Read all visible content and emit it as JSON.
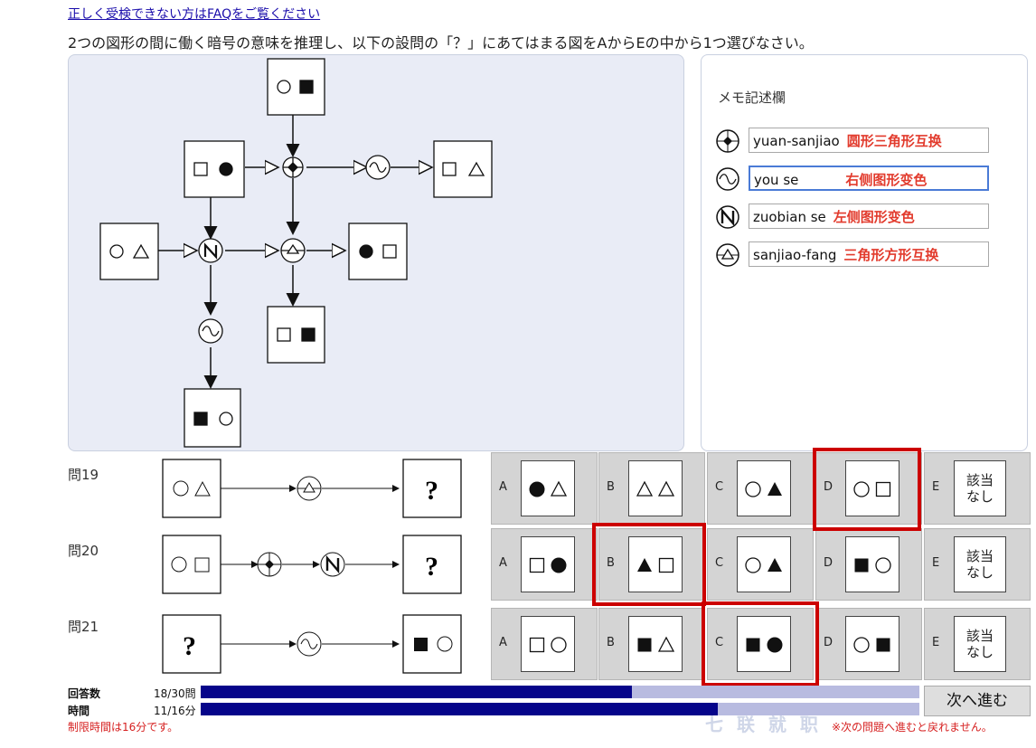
{
  "header": {
    "faq_link": "正しく受検できない方はFAQをご覧ください",
    "instruction": "2つの図形の間に働く暗号の意味を推理し、以下の設問の「？」にあてはまる図をAからEの中から1つ選びなさい。"
  },
  "memo": {
    "title": "メモ記述欄",
    "rows": [
      {
        "icon": "cross-circle-icon",
        "key": "yuan-sanjiao",
        "note": "圆形三角形互换"
      },
      {
        "icon": "wave-circle-icon",
        "key": "you se",
        "note": "右侧图形变色"
      },
      {
        "icon": "n-circle-icon",
        "key": "zuobian se",
        "note": "左侧图形变色"
      },
      {
        "icon": "triangle-circle-icon",
        "key": "sanjiao-fang",
        "note": "三角形方形互换"
      }
    ]
  },
  "questions": [
    {
      "label": "問19",
      "left_shapes": [
        "circle-empty",
        "triangle-empty"
      ],
      "ops": [
        "triangle-circle-icon"
      ],
      "question_mark": "?",
      "right": "?"
    },
    {
      "label": "問20",
      "left_shapes": [
        "circle-empty",
        "square-empty"
      ],
      "ops": [
        "cross-circle-icon",
        "n-circle-icon"
      ],
      "question_mark": "?",
      "right": "?"
    },
    {
      "label": "問21",
      "left": "?",
      "ops": [
        "wave-circle-icon"
      ],
      "question_mark": "?",
      "right_shapes": [
        "square-filled",
        "circle-empty"
      ]
    }
  ],
  "options": {
    "letters": [
      "A",
      "B",
      "C",
      "D",
      "E"
    ],
    "none_label_1": "該当",
    "none_label_2": "なし",
    "q19": [
      [
        "circle-filled",
        "triangle-empty"
      ],
      [
        "triangle-empty",
        "triangle-empty"
      ],
      [
        "circle-empty",
        "triangle-filled"
      ],
      [
        "circle-empty",
        "square-empty"
      ]
    ],
    "q20": [
      [
        "square-empty",
        "circle-filled"
      ],
      [
        "triangle-filled",
        "square-empty"
      ],
      [
        "circle-empty",
        "triangle-filled"
      ],
      [
        "square-filled",
        "circle-empty"
      ]
    ],
    "q21": [
      [
        "square-empty",
        "circle-empty"
      ],
      [
        "square-filled",
        "triangle-empty"
      ],
      [
        "square-filled",
        "circle-filled"
      ],
      [
        "circle-empty",
        "square-filled"
      ]
    ],
    "highlighted": {
      "q19": "D",
      "q20": "B",
      "q21": "C"
    }
  },
  "status": {
    "answers_label": "回答数",
    "answers_value": "18/30問",
    "answers_progress": 0.6,
    "time_label": "時間",
    "time_value": "11/16分",
    "time_progress": 0.72,
    "time_limit_note": "制限時間は16分です。",
    "no_return_note": "※次の問題へ進むと戻れません。"
  },
  "next_button": "次へ進む",
  "watermark": "七 联 就 职",
  "colors": {
    "accent_blue": "#06058a",
    "highlight_red": "#cc0000",
    "memo_red": "#e23b2d"
  }
}
